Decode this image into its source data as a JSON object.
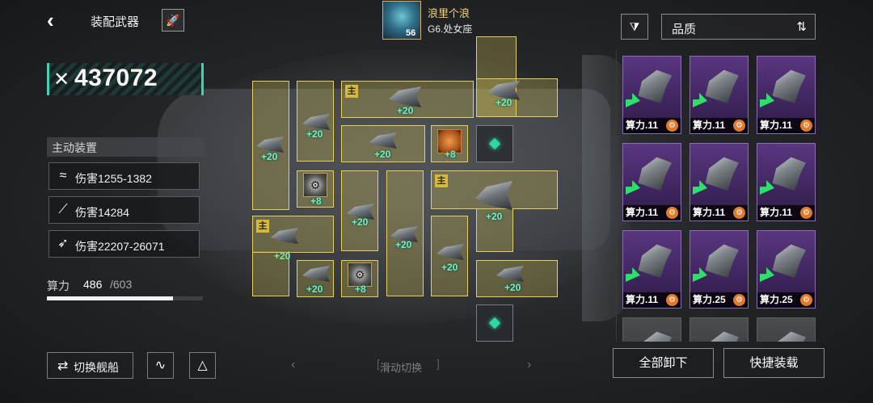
{
  "header": {
    "title": "装配武器",
    "back_icon": "‹",
    "rocket_icon": "🚀"
  },
  "player": {
    "name": "浪里个浪",
    "level": "56",
    "rank": "G6.处女座"
  },
  "power": {
    "icon": "✕",
    "value": "437072"
  },
  "active_device": {
    "title": "主动装置",
    "stats": [
      {
        "icon": "≈",
        "text": "伤害1255-1382"
      },
      {
        "icon": "⟋",
        "text": "伤害14284"
      },
      {
        "icon": "➶",
        "text": "伤害22207-26071"
      }
    ]
  },
  "compute": {
    "label": "算力",
    "current": "486",
    "max": "/603",
    "fraction": 0.806
  },
  "bottom": {
    "switch_label": "切换舰船",
    "switch_icon": "⇄",
    "swipe_text": "滑动切换",
    "swipe_left": "‹",
    "swipe_right": "›"
  },
  "slots": {
    "main_tag": "主",
    "plus20": "+20",
    "plus8": "+8"
  },
  "inventory": {
    "filter_icon": "⧩",
    "sort_label": "品质",
    "sort_icon": "⇅",
    "cards": [
      {
        "label": "算力.11"
      },
      {
        "label": "算力.11"
      },
      {
        "label": "算力.11"
      },
      {
        "label": "算力.11"
      },
      {
        "label": "算力.11"
      },
      {
        "label": "算力.11"
      },
      {
        "label": "算力.11"
      },
      {
        "label": "算力.25"
      },
      {
        "label": "算力.25"
      }
    ],
    "unequip_all": "全部卸下",
    "quick_equip": "快捷装载"
  }
}
